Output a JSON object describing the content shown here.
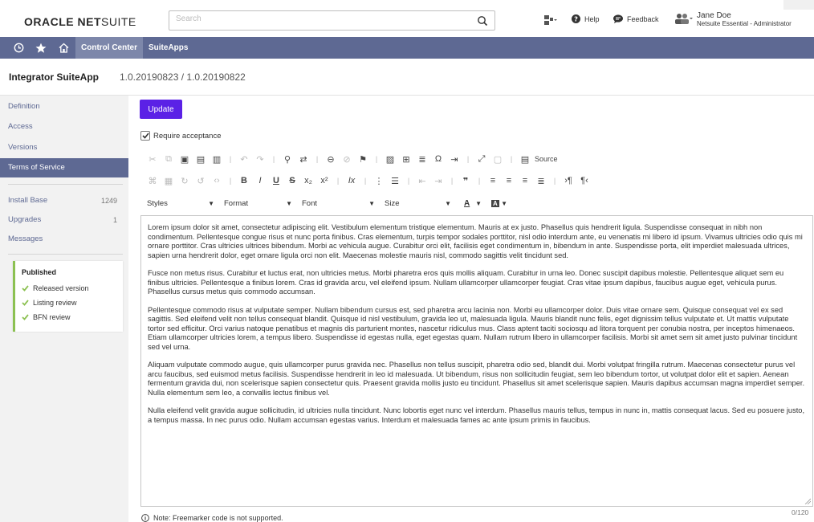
{
  "header": {
    "logo_bold": "ORACLE",
    "logo_rest": "NET",
    "logo_thin": "SUITE",
    "search_placeholder": "Search",
    "help_label": "Help",
    "feedback_label": "Feedback",
    "user_name": "Jane Doe",
    "user_role": "Netsuite Essential - Administrator"
  },
  "nav": {
    "items": [
      {
        "label": "Control Center",
        "active": true
      },
      {
        "label": "SuiteApps",
        "active": false
      }
    ]
  },
  "page": {
    "title": "Integrator SuiteApp",
    "version": "1.0.20190823 / 1.0.20190822"
  },
  "sidebar": {
    "items": [
      {
        "label": "Definition"
      },
      {
        "label": "Access"
      },
      {
        "label": "Versions"
      },
      {
        "label": "Terms of Service"
      }
    ],
    "stats": [
      {
        "label": "Install Base",
        "count": "1249"
      },
      {
        "label": "Upgrades",
        "count": "1"
      },
      {
        "label": "Messages",
        "count": ""
      }
    ],
    "published": {
      "title": "Published",
      "items": [
        "Released version",
        "Listing review",
        "BFN review"
      ]
    }
  },
  "main": {
    "update_label": "Update",
    "require_acceptance_label": "Require acceptance",
    "toolbar": {
      "source_label": "Source",
      "combos": [
        "Styles",
        "Format",
        "Font",
        "Size"
      ]
    },
    "editor_paragraphs": [
      "Lorem ipsum dolor sit amet, consectetur adipiscing elit. Vestibulum elementum tristique elementum. Mauris at ex justo. Phasellus quis hendrerit ligula. Suspendisse consequat in nibh non condimentum. Pellentesque congue risus et nunc porta finibus. Cras elementum, turpis tempor sodales porttitor, nisl odio interdum ante, eu venenatis mi libero id ipsum. Vivamus ultricies odio quis mi ornare porttitor. Cras ultricies ultrices bibendum. Morbi ac vehicula augue. Curabitur orci elit, facilisis eget condimentum in, bibendum in ante. Suspendisse porta, elit imperdiet malesuada ultrices, sapien urna hendrerit dolor, eget ornare ligula orci non elit. Maecenas molestie mauris nisl, commodo sagittis velit tincidunt sed.",
      "Fusce non metus risus. Curabitur et luctus erat, non ultricies metus. Morbi pharetra eros quis mollis aliquam. Curabitur in urna leo. Donec suscipit dapibus molestie. Pellentesque aliquet sem eu finibus ultricies. Pellentesque a finibus lorem. Cras id gravida arcu, vel eleifend ipsum. Nullam ullamcorper ullamcorper feugiat. Cras vitae ipsum dapibus, faucibus augue eget, vehicula purus. Phasellus cursus metus quis commodo accumsan.",
      "Pellentesque commodo risus at vulputate semper. Nullam bibendum cursus est, sed pharetra arcu lacinia non. Morbi eu ullamcorper dolor. Duis vitae ornare sem. Quisque consequat vel ex sed sagittis. Sed eleifend velit non tellus consequat blandit. Quisque id nisl vestibulum, gravida leo ut, malesuada ligula. Mauris blandit nunc felis, eget dignissim tellus vulputate et. Ut mattis vulputate tortor sed efficitur. Orci varius natoque penatibus et magnis dis parturient montes, nascetur ridiculus mus. Class aptent taciti sociosqu ad litora torquent per conubia nostra, per inceptos himenaeos. Etiam ullamcorper ultricies lorem, a tempus libero. Suspendisse id egestas nulla, eget egestas quam. Nullam rutrum libero in ullamcorper facilisis. Morbi sit amet sem sit amet justo pulvinar tincidunt sed vel urna.",
      "Aliquam vulputate commodo augue, quis ullamcorper purus gravida nec. Phasellus non tellus suscipit, pharetra odio sed, blandit dui. Morbi volutpat fringilla rutrum. Maecenas consectetur purus vel arcu faucibus, sed euismod metus facilisis. Suspendisse hendrerit in leo id malesuada. Ut bibendum, risus non sollicitudin feugiat, sem leo bibendum tortor, ut volutpat dolor elit et sapien. Aenean fermentum gravida dui, non scelerisque sapien consectetur quis. Praesent gravida mollis justo eu tincidunt. Phasellus sit amet scelerisque sapien. Mauris dapibus accumsan magna imperdiet semper. Nulla elementum sem leo, a convallis lectus finibus vel.",
      "Nulla eleifend velit gravida augue sollicitudin, id ultricies nulla tincidunt. Nunc lobortis eget nunc vel interdum. Phasellus mauris tellus, tempus in nunc in, mattis consequat lacus. Sed eu posuere justo, a tempus massa. In nec purus odio. Nullam accumsan egestas varius. Interdum et malesuada fames ac ante ipsum primis in faucibus."
    ],
    "char_counter": "0/120",
    "note": "Note: Freemarker code is not supported."
  },
  "colors": {
    "nav_bg": "#5e6993",
    "accent_button": "#5b21e6",
    "published_check": "#8cc152"
  }
}
